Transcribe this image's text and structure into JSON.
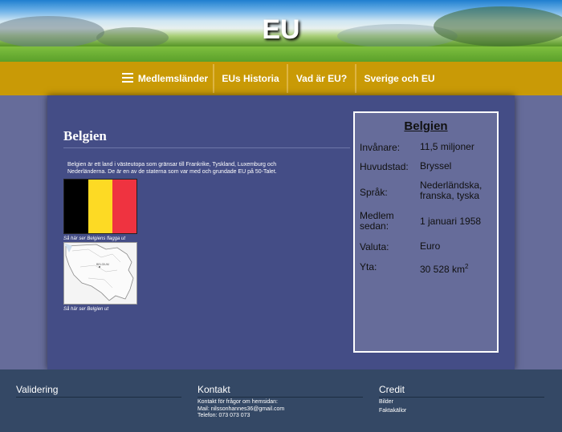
{
  "header": {
    "title": "EU"
  },
  "nav": {
    "items": [
      {
        "label": "Medlemsländer"
      },
      {
        "label": "EUs Historia"
      },
      {
        "label": "Vad är EU?"
      },
      {
        "label": "Sverige och EU"
      }
    ]
  },
  "main": {
    "heading": "Belgien",
    "intro": "Belgien är ett land i västeutopa som gränsar till Frankrike, Tyskland, Luxemburg och Nederländerna. De är en av de staterna som var med och grundade EU på 50-Talet.",
    "flag_caption": "Så här ser Belgiens flagga ut",
    "map_caption": "Så här ser Belgien ut",
    "map_label": "BELGIUM",
    "flag_colors": [
      "#000000",
      "#fdda24",
      "#ef3340"
    ]
  },
  "facts": {
    "title": "Belgien",
    "rows": [
      {
        "key": "Invånare:",
        "value": "11,5 miljoner"
      },
      {
        "key": "Huvudstad:",
        "value": "Bryssel"
      },
      {
        "key": "Språk:",
        "value": "Nederländska, franska, tyska"
      },
      {
        "key": "Medlem sedan:",
        "value": "1 januari 1958"
      },
      {
        "key": "Valuta:",
        "value": "Euro"
      },
      {
        "key": "Yta:",
        "value": "30 528 km",
        "sup": "2"
      }
    ]
  },
  "footer": {
    "validation": {
      "title": "Validering"
    },
    "contact": {
      "title": "Kontakt",
      "lines": [
        "Kontakt för frågor om hemsidan:",
        "Mail: nilssonhannes36@gmail.com",
        "Telefon: 073 073 073"
      ]
    },
    "credit": {
      "title": "Credit",
      "links": [
        "Bilder",
        "Faktakällor"
      ]
    }
  }
}
